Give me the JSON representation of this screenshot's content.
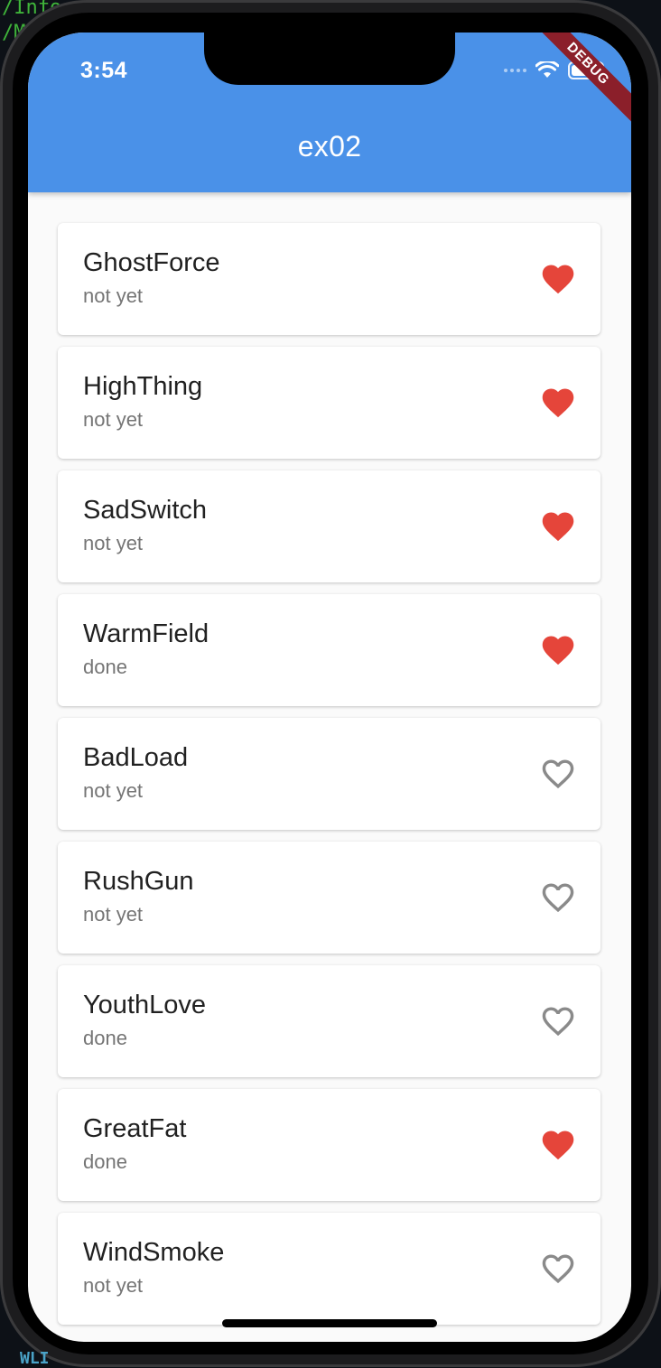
{
  "terminal": {
    "line1": "/Info",
    "line2": "/M",
    "bottom": "WLI"
  },
  "status_bar": {
    "time": "3:54",
    "icons": [
      "cellular-dots-icon",
      "wifi-icon",
      "battery-icon"
    ]
  },
  "debug_banner": "DEBUG",
  "appbar": {
    "title": "ex02",
    "color": "#4a91e8"
  },
  "colors": {
    "favorite": "#e5453a",
    "not_favorite": "#8a8a8a",
    "background": "#fafafa"
  },
  "items": [
    {
      "title": "GhostForce",
      "status": "not yet",
      "favorite": true
    },
    {
      "title": "HighThing",
      "status": "not yet",
      "favorite": true
    },
    {
      "title": "SadSwitch",
      "status": "not yet",
      "favorite": true
    },
    {
      "title": "WarmField",
      "status": "done",
      "favorite": true
    },
    {
      "title": "BadLoad",
      "status": "not yet",
      "favorite": false
    },
    {
      "title": "RushGun",
      "status": "not yet",
      "favorite": false
    },
    {
      "title": "YouthLove",
      "status": "done",
      "favorite": false
    },
    {
      "title": "GreatFat",
      "status": "done",
      "favorite": true
    },
    {
      "title": "WindSmoke",
      "status": "not yet",
      "favorite": false
    }
  ]
}
